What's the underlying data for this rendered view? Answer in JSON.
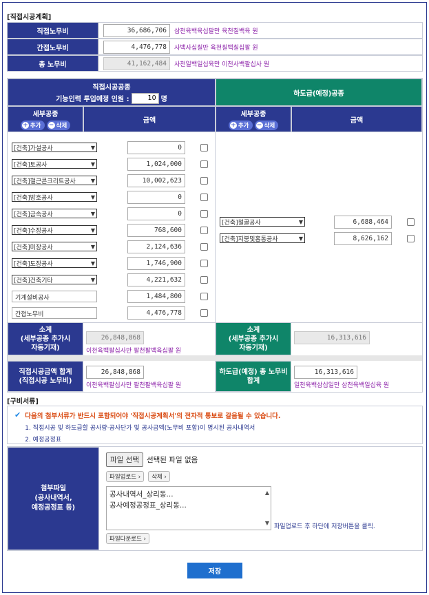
{
  "section1_title": "[직접시공계획]",
  "summary": [
    {
      "label": "직접노무비",
      "value": "36,686,706",
      "words": "삼천육백육십팔만 육천칠백육 원",
      "readonly": false
    },
    {
      "label": "간접노무비",
      "value": "4,476,778",
      "words": "사백사십칠만 육천칠백칠십팔 원",
      "readonly": false
    },
    {
      "label": "총 노무비",
      "value": "41,162,484",
      "words": "사천일백일십육만 이천사백팔십사 원",
      "readonly": true
    }
  ],
  "direct": {
    "header_line1": "직접시공공종",
    "header_line2_prefix": "기능인력 투입예정 인원 :",
    "workers": "10",
    "workers_unit": "명",
    "col_work": "세부공종",
    "col_amount": "금액",
    "add_label": "추가",
    "delete_label": "삭제",
    "rows": [
      {
        "type": "select",
        "name": "[건축]가설공사",
        "amount": "0"
      },
      {
        "type": "select",
        "name": "[건축]토공사",
        "amount": "1,024,000"
      },
      {
        "type": "select",
        "name": "[건축]철근콘크리트공사",
        "amount": "10,002,623"
      },
      {
        "type": "select",
        "name": "[건축]방호공사",
        "amount": "0"
      },
      {
        "type": "select",
        "name": "[건축]금속공사",
        "amount": "0"
      },
      {
        "type": "select",
        "name": "[건축]수장공사",
        "amount": "768,600"
      },
      {
        "type": "select",
        "name": "[건축]미장공사",
        "amount": "2,124,636"
      },
      {
        "type": "select",
        "name": "[건축]도장공사",
        "amount": "1,746,900"
      },
      {
        "type": "select",
        "name": "[건축]건축기타",
        "amount": "4,221,632"
      },
      {
        "type": "text",
        "name": "기계설비공사",
        "amount": "1,484,800"
      },
      {
        "type": "text",
        "name": "간접노무비",
        "amount": "4,476,778"
      }
    ],
    "subtotal_label1": "소계",
    "subtotal_label2": "(세부공종 추가시",
    "subtotal_label3": "자동기재)",
    "subtotal_value": "26,848,868",
    "subtotal_words": "이천육백팔십사만 팔천팔백육십팔 원",
    "total_label1": "직접시공금액 합계",
    "total_label2": "(직접시공 노무비)",
    "total_value": "26,848,868",
    "total_words": "이천육백팔십사만 팔천팔백육십팔 원"
  },
  "sub": {
    "header": "하도급(예정)공종",
    "col_work": "세부공종",
    "col_amount": "금액",
    "add_label": "추가",
    "delete_label": "삭제",
    "rows": [
      {
        "name": "[건축]철골공사",
        "amount": "6,688,464"
      },
      {
        "name": "[건축]지붕및홈통공사",
        "amount": "8,626,162"
      }
    ],
    "subtotal_label1": "소계",
    "subtotal_label2": "(세부공종 추가시",
    "subtotal_label3": "자동기재)",
    "subtotal_value": "16,313,616",
    "total_label1": "하도급(예정) 총 노무비",
    "total_label2": "합계",
    "total_value": "16,313,616",
    "total_words": "일천육백삼십일만 삼천육백일십육 원"
  },
  "section2_title": "[구비서류]",
  "docs_notice": {
    "warning": "다음의 첨부서류가 반드시 포함되어야 '직접시공계획서'의 전자적 통보로 갈음될 수 있습니다.",
    "item1": "1. 직접시공 및 하도급할 공사량·공사단가 및 공사금액(노무비 포함)이 명시된 공사내역서",
    "item2": "2. 예정공정표"
  },
  "attach": {
    "label1": "첨부파일",
    "label2": "(공사내역서,",
    "label3": "예정공정표 등)",
    "choose_button": "파일 선택",
    "no_file": "선택된 파일 없음",
    "upload_button": "파일업로드",
    "delete_button": "삭제",
    "files": [
      "공사내역서_상리동...",
      "공사예정공정표_상리동..."
    ],
    "hint": "파일업로드 후 하단에 저장버튼을 클릭.",
    "download_button": "파일다운로드"
  },
  "save_button": "저장",
  "colors": {
    "blue": "#2b3990",
    "green": "#0f8569",
    "words": "#8b1fa8",
    "save": "#1f6fce"
  }
}
